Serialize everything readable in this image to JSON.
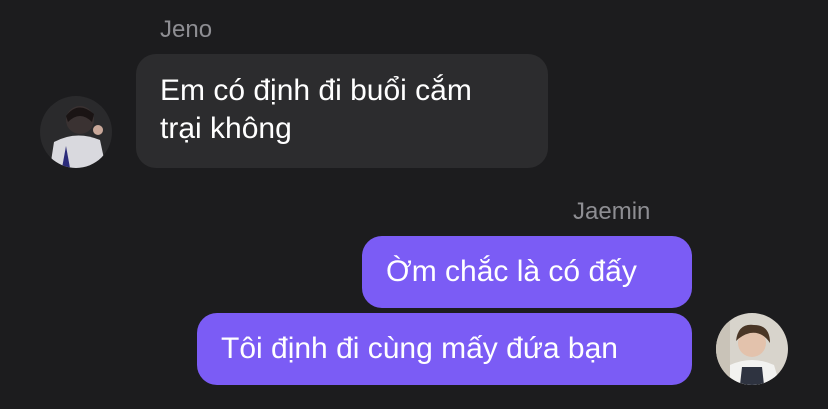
{
  "conversation": {
    "messages": [
      {
        "sender": "Jeno",
        "direction": "incoming",
        "lines": [
          "Em có định đi buổi cắm",
          "trại không"
        ]
      },
      {
        "sender": "Jaemin",
        "direction": "outgoing",
        "lines": [
          "Ờm chắc là có đấy"
        ]
      },
      {
        "sender": "Jaemin",
        "direction": "outgoing",
        "lines": [
          "Tôi định đi cùng mấy đứa bạn"
        ]
      }
    ],
    "incoming_sender_name": "Jeno",
    "outgoing_sender_name": "Jaemin"
  },
  "colors": {
    "background": "#1c1c1e",
    "incoming_bubble": "#2c2c2e",
    "outgoing_bubble": "#7b5cf5",
    "sender_name": "#8e8e93"
  },
  "avatars": {
    "incoming": "jeno-avatar-photo",
    "outgoing": "jaemin-avatar-photo"
  }
}
